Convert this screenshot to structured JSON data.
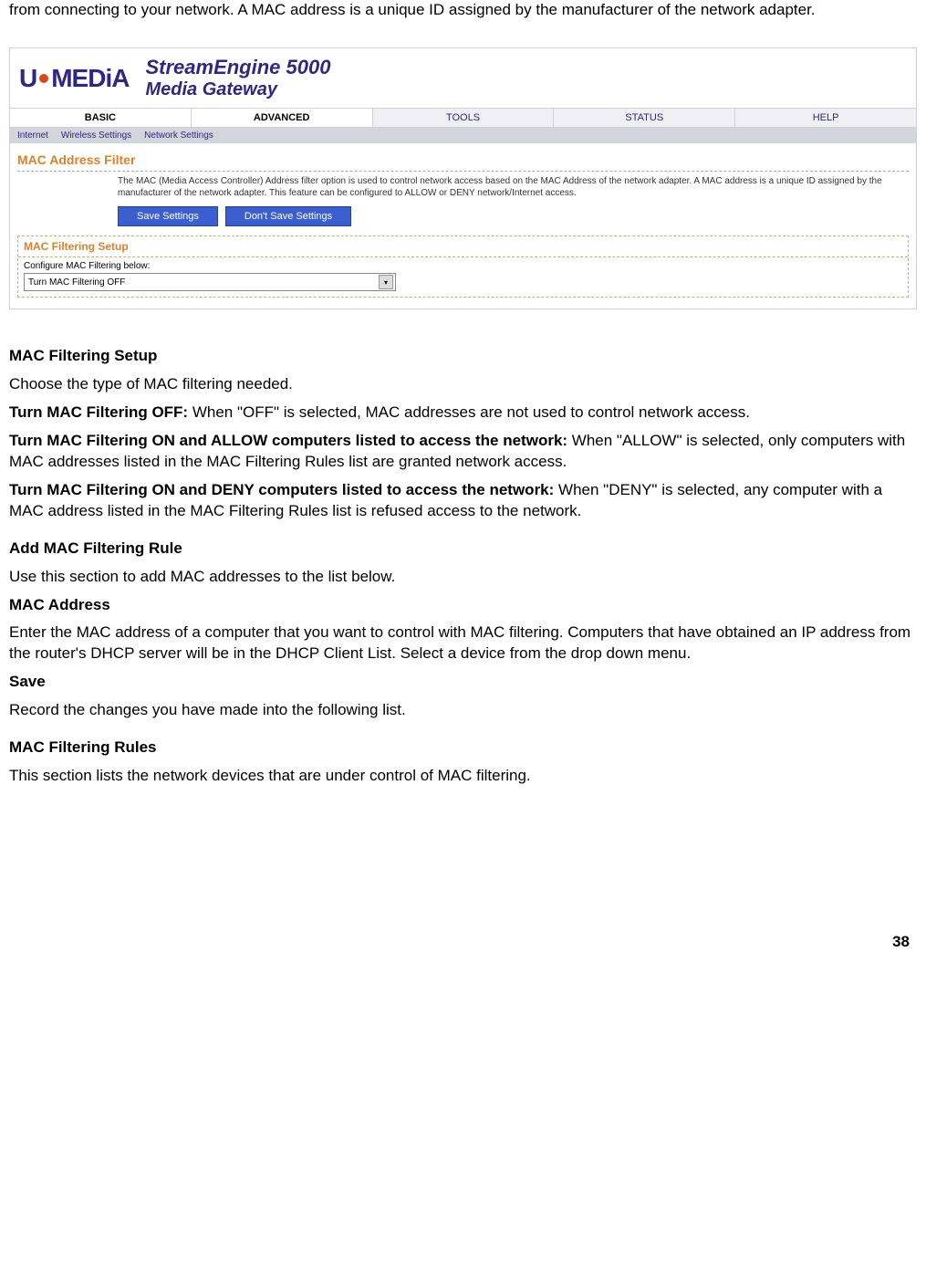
{
  "intro": "from connecting to your network. A MAC address is a unique ID assigned by the manufacturer of the network adapter.",
  "router": {
    "logo_left": "U",
    "logo_right": "MEDiA",
    "product_line1": "StreamEngine 5000",
    "product_line2": "Media Gateway",
    "tabs": {
      "basic": "BASIC",
      "advanced": "ADVANCED",
      "tools": "TOOLS",
      "status": "STATUS",
      "help": "HELP"
    },
    "subtabs": {
      "internet": "Internet",
      "wireless": "Wireless Settings",
      "network": "Network Settings"
    },
    "mac_filter_title": "MAC Address Filter",
    "mac_filter_desc": "The MAC (Media Access Controller) Address filter option is used to control network access based on the MAC Address of the network adapter. A MAC address is a unique ID assigned by the manufacturer of the network adapter. This feature can be configured to ALLOW or DENY network/Internet access.",
    "save_btn": "Save Settings",
    "dont_save_btn": "Don't Save Settings",
    "setup_title": "MAC Filtering Setup",
    "setup_label": "Configure MAC Filtering below:",
    "dropdown_value": "Turn MAC Filtering OFF"
  },
  "sections": {
    "h1": "MAC Filtering Setup",
    "p1": "Choose the type of MAC filtering needed.",
    "off_label": "Turn MAC Filtering OFF:",
    "off_text": " When \"OFF\" is selected, MAC addresses are not used to control network access.",
    "allow_label": "Turn MAC Filtering ON and ALLOW computers listed to access the network:",
    "allow_text": " When \"ALLOW\" is selected, only computers with MAC addresses listed in the MAC Filtering Rules list are granted network access.",
    "deny_label": "Turn MAC Filtering ON and DENY computers listed to access the network:",
    "deny_text": " When \"DENY\" is selected, any computer with a MAC address listed in the MAC Filtering Rules list is refused access to the network.",
    "h2": "Add MAC Filtering Rule",
    "p2": "Use this section to add MAC addresses to the list below.",
    "mac_addr_label": "MAC Address",
    "mac_addr_text": "Enter the MAC address of a computer that you want to control with MAC filtering. Computers that have obtained an IP address from the router's DHCP server will be in the DHCP Client List. Select a device from the drop down menu.",
    "save_label": "Save",
    "save_text": "Record the changes you have made into the following list.",
    "h3": "MAC Filtering Rules",
    "p3": "This section lists the network devices that are under control of MAC filtering."
  },
  "page_number": "38"
}
